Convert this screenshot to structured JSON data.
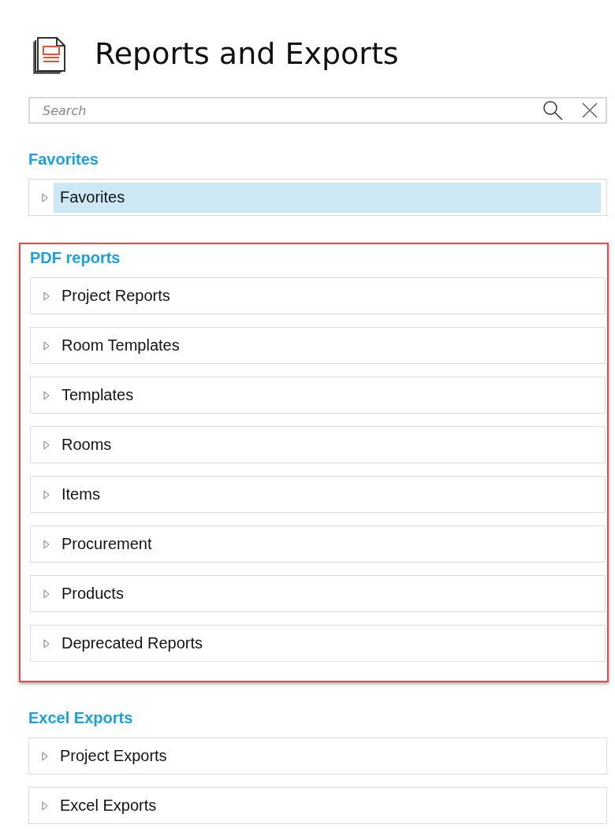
{
  "title": "Reports and Exports",
  "search": {
    "placeholder": "Search"
  },
  "sections": [
    {
      "heading": "Favorites",
      "highlighted": false,
      "items": [
        {
          "label": "Favorites",
          "selected": true
        }
      ]
    },
    {
      "heading": "PDF reports",
      "highlighted": true,
      "items": [
        {
          "label": "Project Reports",
          "selected": false
        },
        {
          "label": "Room Templates",
          "selected": false
        },
        {
          "label": "Templates",
          "selected": false
        },
        {
          "label": "Rooms",
          "selected": false
        },
        {
          "label": "Items",
          "selected": false
        },
        {
          "label": "Procurement",
          "selected": false
        },
        {
          "label": "Products",
          "selected": false
        },
        {
          "label": "Deprecated Reports",
          "selected": false
        }
      ]
    },
    {
      "heading": "Excel Exports",
      "highlighted": false,
      "items": [
        {
          "label": "Project Exports",
          "selected": false
        },
        {
          "label": "Excel Exports",
          "selected": false
        }
      ]
    }
  ]
}
